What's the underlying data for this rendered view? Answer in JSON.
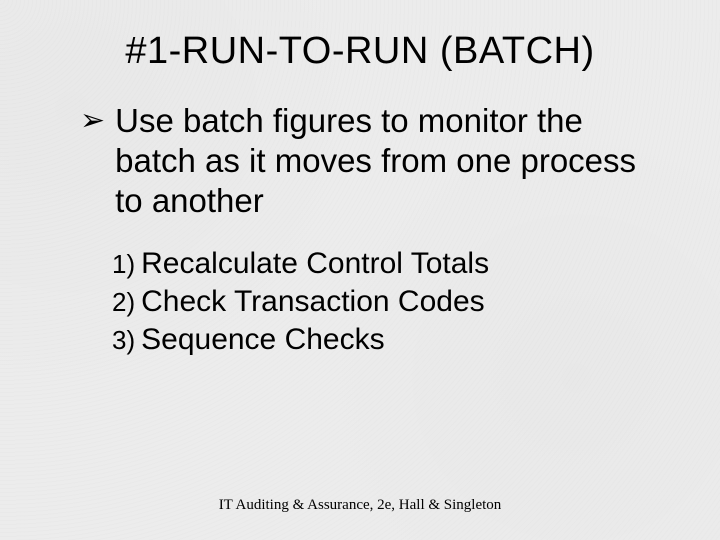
{
  "title": "#1-RUN-TO-RUN (BATCH)",
  "bullet": {
    "marker": "➢",
    "text": "Use batch figures to monitor the batch as it moves from one process to another"
  },
  "numbered": [
    {
      "n": "1)",
      "text": "Recalculate Control Totals"
    },
    {
      "n": "2)",
      "text": "Check Transaction Codes"
    },
    {
      "n": "3)",
      "text": "Sequence Checks"
    }
  ],
  "footer": "IT Auditing & Assurance, 2e, Hall & Singleton"
}
